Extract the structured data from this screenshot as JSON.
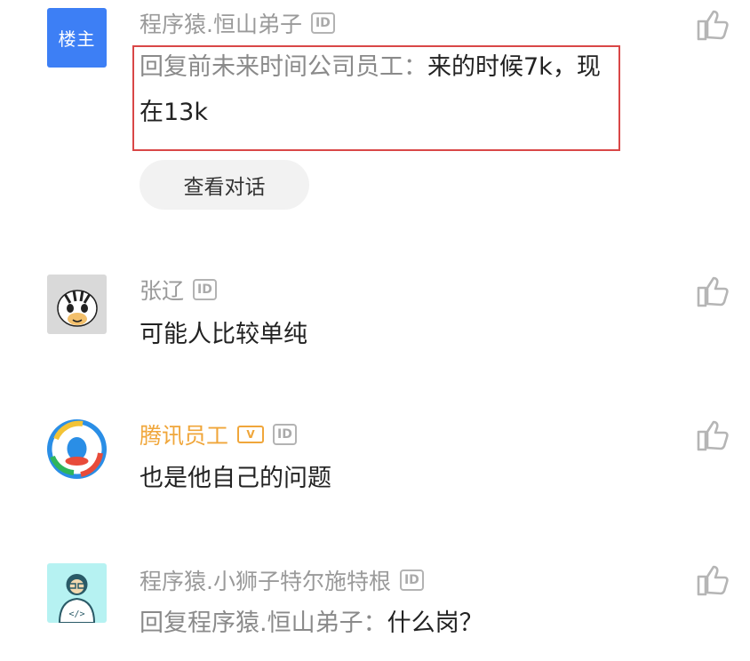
{
  "comments": [
    {
      "avatar_label": "楼主",
      "username": "程序猿.恒山弟子",
      "id_badge": "ID",
      "text_prefix": "回复前未来时间公司员工：",
      "text_body": "来的时候7k，现在13k",
      "view_thread_label": "查看对话"
    },
    {
      "username": "张辽",
      "id_badge": "ID",
      "text_body": "可能人比较单纯"
    },
    {
      "username": "腾讯员工",
      "verified_badge": "V",
      "id_badge": "ID",
      "text_body": "也是他自己的问题"
    },
    {
      "username": "程序猿.小狮子特尔施特根",
      "id_badge": "ID",
      "text_prefix": "回复程序猿.恒山弟子：",
      "text_body": "什么岗？"
    }
  ],
  "icons": {
    "like": "thumbs-up-icon"
  },
  "colors": {
    "accent_owner": "#3d7ff5",
    "employee_name": "#f0a63a",
    "highlight_box": "#d94747"
  }
}
